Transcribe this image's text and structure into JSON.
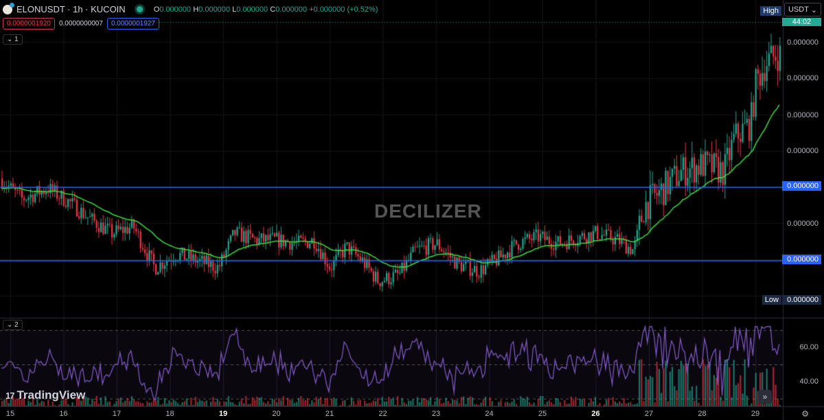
{
  "header": {
    "symbol": "ELONUSDT · 1h · KUCOIN",
    "o_label": "O",
    "o": "0.000000",
    "h_label": "H",
    "h": "0.000000",
    "l_label": "L",
    "l": "0.000000",
    "c_label": "C",
    "c": "0.000000",
    "change": "+0.000000 (+0.52%)",
    "bid": "0.0000001920",
    "spread": "0.0000000007",
    "ask": "0.0000001927",
    "pane1_toggle": "1",
    "pane2_toggle": "2"
  },
  "axis": {
    "currency": "USDT",
    "timer": "44:02",
    "high_label": "High",
    "low_label": "Low",
    "high_value": "0.000000",
    "low_value": "0.000000",
    "price_labels": [
      "0.000000",
      "0.000000",
      "0.000000",
      "0.000000",
      "0.000000"
    ],
    "line_tags": [
      "0.000000",
      "0.000000"
    ],
    "rsi_labels": [
      "60.00",
      "40.00"
    ]
  },
  "watermark": "DECILIZER",
  "brand": "TradingView",
  "colors": {
    "up": "#22ab94",
    "down": "#f23645",
    "ma": "#3bdc3b",
    "rsi": "#7e57c2",
    "hline": "#2962ff"
  },
  "chart_data": {
    "type": "candlestick",
    "title": "ELONUSDT · 1h · KUCOIN",
    "x_unit": "day of month",
    "price_index_note": "relative scale 0 (Low) to 100 (High)",
    "close_path": {
      "x": [
        14.8,
        15.2,
        15.7,
        16.1,
        16.5,
        16.9,
        17.3,
        17.7,
        18.1,
        18.5,
        18.9,
        19.2,
        19.6,
        20.0,
        20.4,
        20.7,
        21.0,
        21.3,
        21.6,
        21.9,
        22.3,
        22.6,
        23.0,
        23.4,
        23.8,
        24.2,
        24.5,
        24.9,
        25.3,
        25.7,
        26.0,
        26.4,
        26.7,
        26.9,
        27.2,
        27.6,
        28.0,
        28.4,
        28.6,
        28.9,
        29.0,
        29.2,
        29.4
      ],
      "y": [
        43.2,
        35.8,
        39.5,
        34.6,
        28.4,
        23.5,
        25.9,
        11.1,
        16.0,
        13.6,
        11.1,
        23.5,
        21.0,
        21.0,
        19.8,
        21.0,
        11.1,
        18.5,
        13.6,
        6.2,
        8.6,
        17.3,
        19.8,
        12.3,
        9.9,
        14.8,
        19.8,
        22.2,
        19.8,
        22.2,
        23.5,
        21.0,
        17.3,
        33.3,
        38.3,
        45.7,
        48.1,
        45.7,
        58.0,
        63.0,
        77.8,
        85.2,
        87.7
      ]
    },
    "horizontal_lines": [
      40.0,
      13.6
    ],
    "x_ticks": [
      "15",
      "16",
      "17",
      "18",
      "19",
      "20",
      "21",
      "22",
      "23",
      "24",
      "25",
      "26",
      "27",
      "28",
      "29"
    ],
    "rsi": {
      "range": [
        30,
        70
      ],
      "levels": [
        70,
        50,
        30
      ],
      "ticks": [
        "60.00",
        "40.00"
      ]
    }
  }
}
